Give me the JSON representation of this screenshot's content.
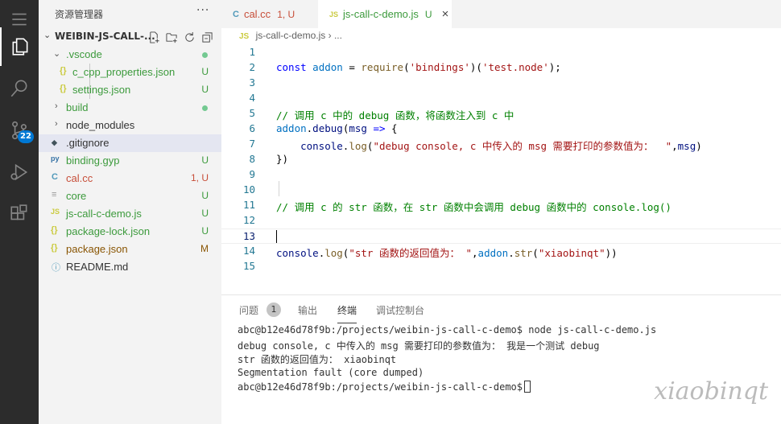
{
  "activity_bar": {
    "items": [
      {
        "name": "menu-icon"
      },
      {
        "name": "explorer-icon"
      },
      {
        "name": "search-icon"
      },
      {
        "name": "source-control-icon",
        "badge": "22"
      },
      {
        "name": "run-debug-icon"
      },
      {
        "name": "extensions-icon"
      }
    ]
  },
  "sidebar": {
    "title": "资源管理器",
    "more": "···",
    "root_label": "WEIBIN-JS-CALL-...",
    "items": [
      {
        "label": ".vscode",
        "type": "folder",
        "status": "dot",
        "color": "#3c9a3c"
      },
      {
        "label": "c_cpp_properties.json",
        "icon": "{}",
        "status": "U",
        "color": "#3c9a3c"
      },
      {
        "label": "settings.json",
        "icon": "{}",
        "status": "U",
        "color": "#3c9a3c"
      },
      {
        "label": "build",
        "type": "folder",
        "status": "dot",
        "color": "#3c9a3c"
      },
      {
        "label": "node_modules",
        "type": "folder",
        "status": "",
        "color": "#333333"
      },
      {
        "label": ".gitignore",
        "icon": "◆",
        "status": "",
        "color": "#333333"
      },
      {
        "label": "binding.gyp",
        "icon": "py",
        "status": "U",
        "color": "#3c9a3c"
      },
      {
        "label": "cal.cc",
        "icon": "C",
        "status": "1, U",
        "color": "#c74e39"
      },
      {
        "label": "core",
        "icon": "≡",
        "status": "U",
        "color": "#3c9a3c"
      },
      {
        "label": "js-call-c-demo.js",
        "icon": "JS",
        "status": "U",
        "color": "#3c9a3c"
      },
      {
        "label": "package-lock.json",
        "icon": "{}",
        "status": "U",
        "color": "#3c9a3c"
      },
      {
        "label": "package.json",
        "icon": "{}",
        "status": "M",
        "color": "#895503"
      },
      {
        "label": "README.md",
        "icon": "ⓘ",
        "status": "",
        "color": "#333333"
      }
    ]
  },
  "tabs": [
    {
      "label": "cal.cc",
      "icon": "C",
      "status": "1, U",
      "color": "#c74e39"
    },
    {
      "label": "js-call-c-demo.js",
      "icon": "JS",
      "status": "U",
      "color": "#3c9a3c",
      "active": true,
      "close": "×"
    }
  ],
  "breadcrumb": {
    "icon": "JS",
    "file": "js-call-c-demo.js",
    "sep": "›",
    "rest": "..."
  },
  "code": {
    "line_numbers": [
      "1",
      "2",
      "3",
      "4",
      "5",
      "6",
      "7",
      "8",
      "9",
      "10",
      "11",
      "12",
      "13",
      "14",
      "15"
    ]
  },
  "panel": {
    "tabs": [
      "问题",
      "输出",
      "终端",
      "调试控制台"
    ],
    "problems_count": "1",
    "active_tab": "终端",
    "terminal_lines": [
      "abc@b12e46d78f9b:/projects/weibin-js-call-c-demo$ node js-call-c-demo.js",
      "debug console, c 中传入的 msg 需要打印的参数值为： 我是一个测试 debug",
      "str 函数的返回值为： xiaobinqt",
      "Segmentation fault (core dumped)",
      "abc@b12e46d78f9b:/projects/weibin-js-call-c-demo$"
    ]
  },
  "watermark": "xiaobinqt",
  "colors": {
    "accent": "#0078d4",
    "untracked": "#3c9a3c",
    "error": "#c74e39",
    "modified": "#895503"
  }
}
